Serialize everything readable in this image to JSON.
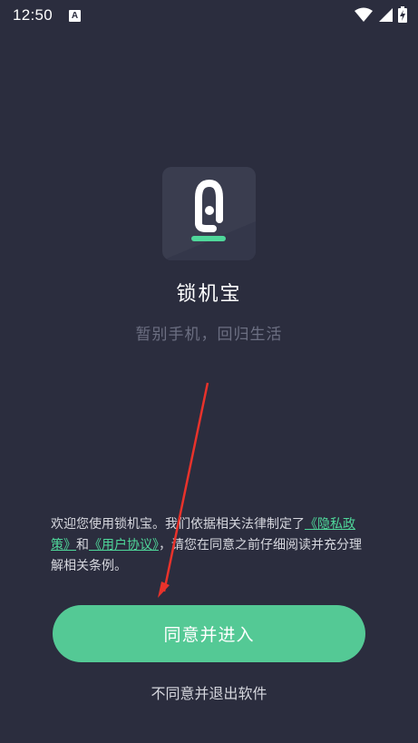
{
  "status_bar": {
    "time": "12:50",
    "notification_icon_letter": "A",
    "icons": [
      "wifi-icon",
      "signal-icon",
      "battery-charging-icon"
    ]
  },
  "app": {
    "name": "锁机宝",
    "slogan": "暂别手机，回归生活",
    "logo_icon": "lock-app-logo-icon",
    "accent_color": "#4fd79a"
  },
  "notice": {
    "text_before": "欢迎您使用锁机宝。我们依据相关法律制定了",
    "privacy_link": "《隐私政策》",
    "and_text": "和",
    "agreement_link": "《用户协议》",
    "text_after": "，请您在同意之前仔细阅读并充分理解相关条例。"
  },
  "buttons": {
    "agree_label": "同意并进入",
    "decline_label": "不同意并退出软件"
  },
  "colors": {
    "background": "#2b2d3e",
    "primary_button": "#54c995",
    "arrow": "#e8322b"
  }
}
